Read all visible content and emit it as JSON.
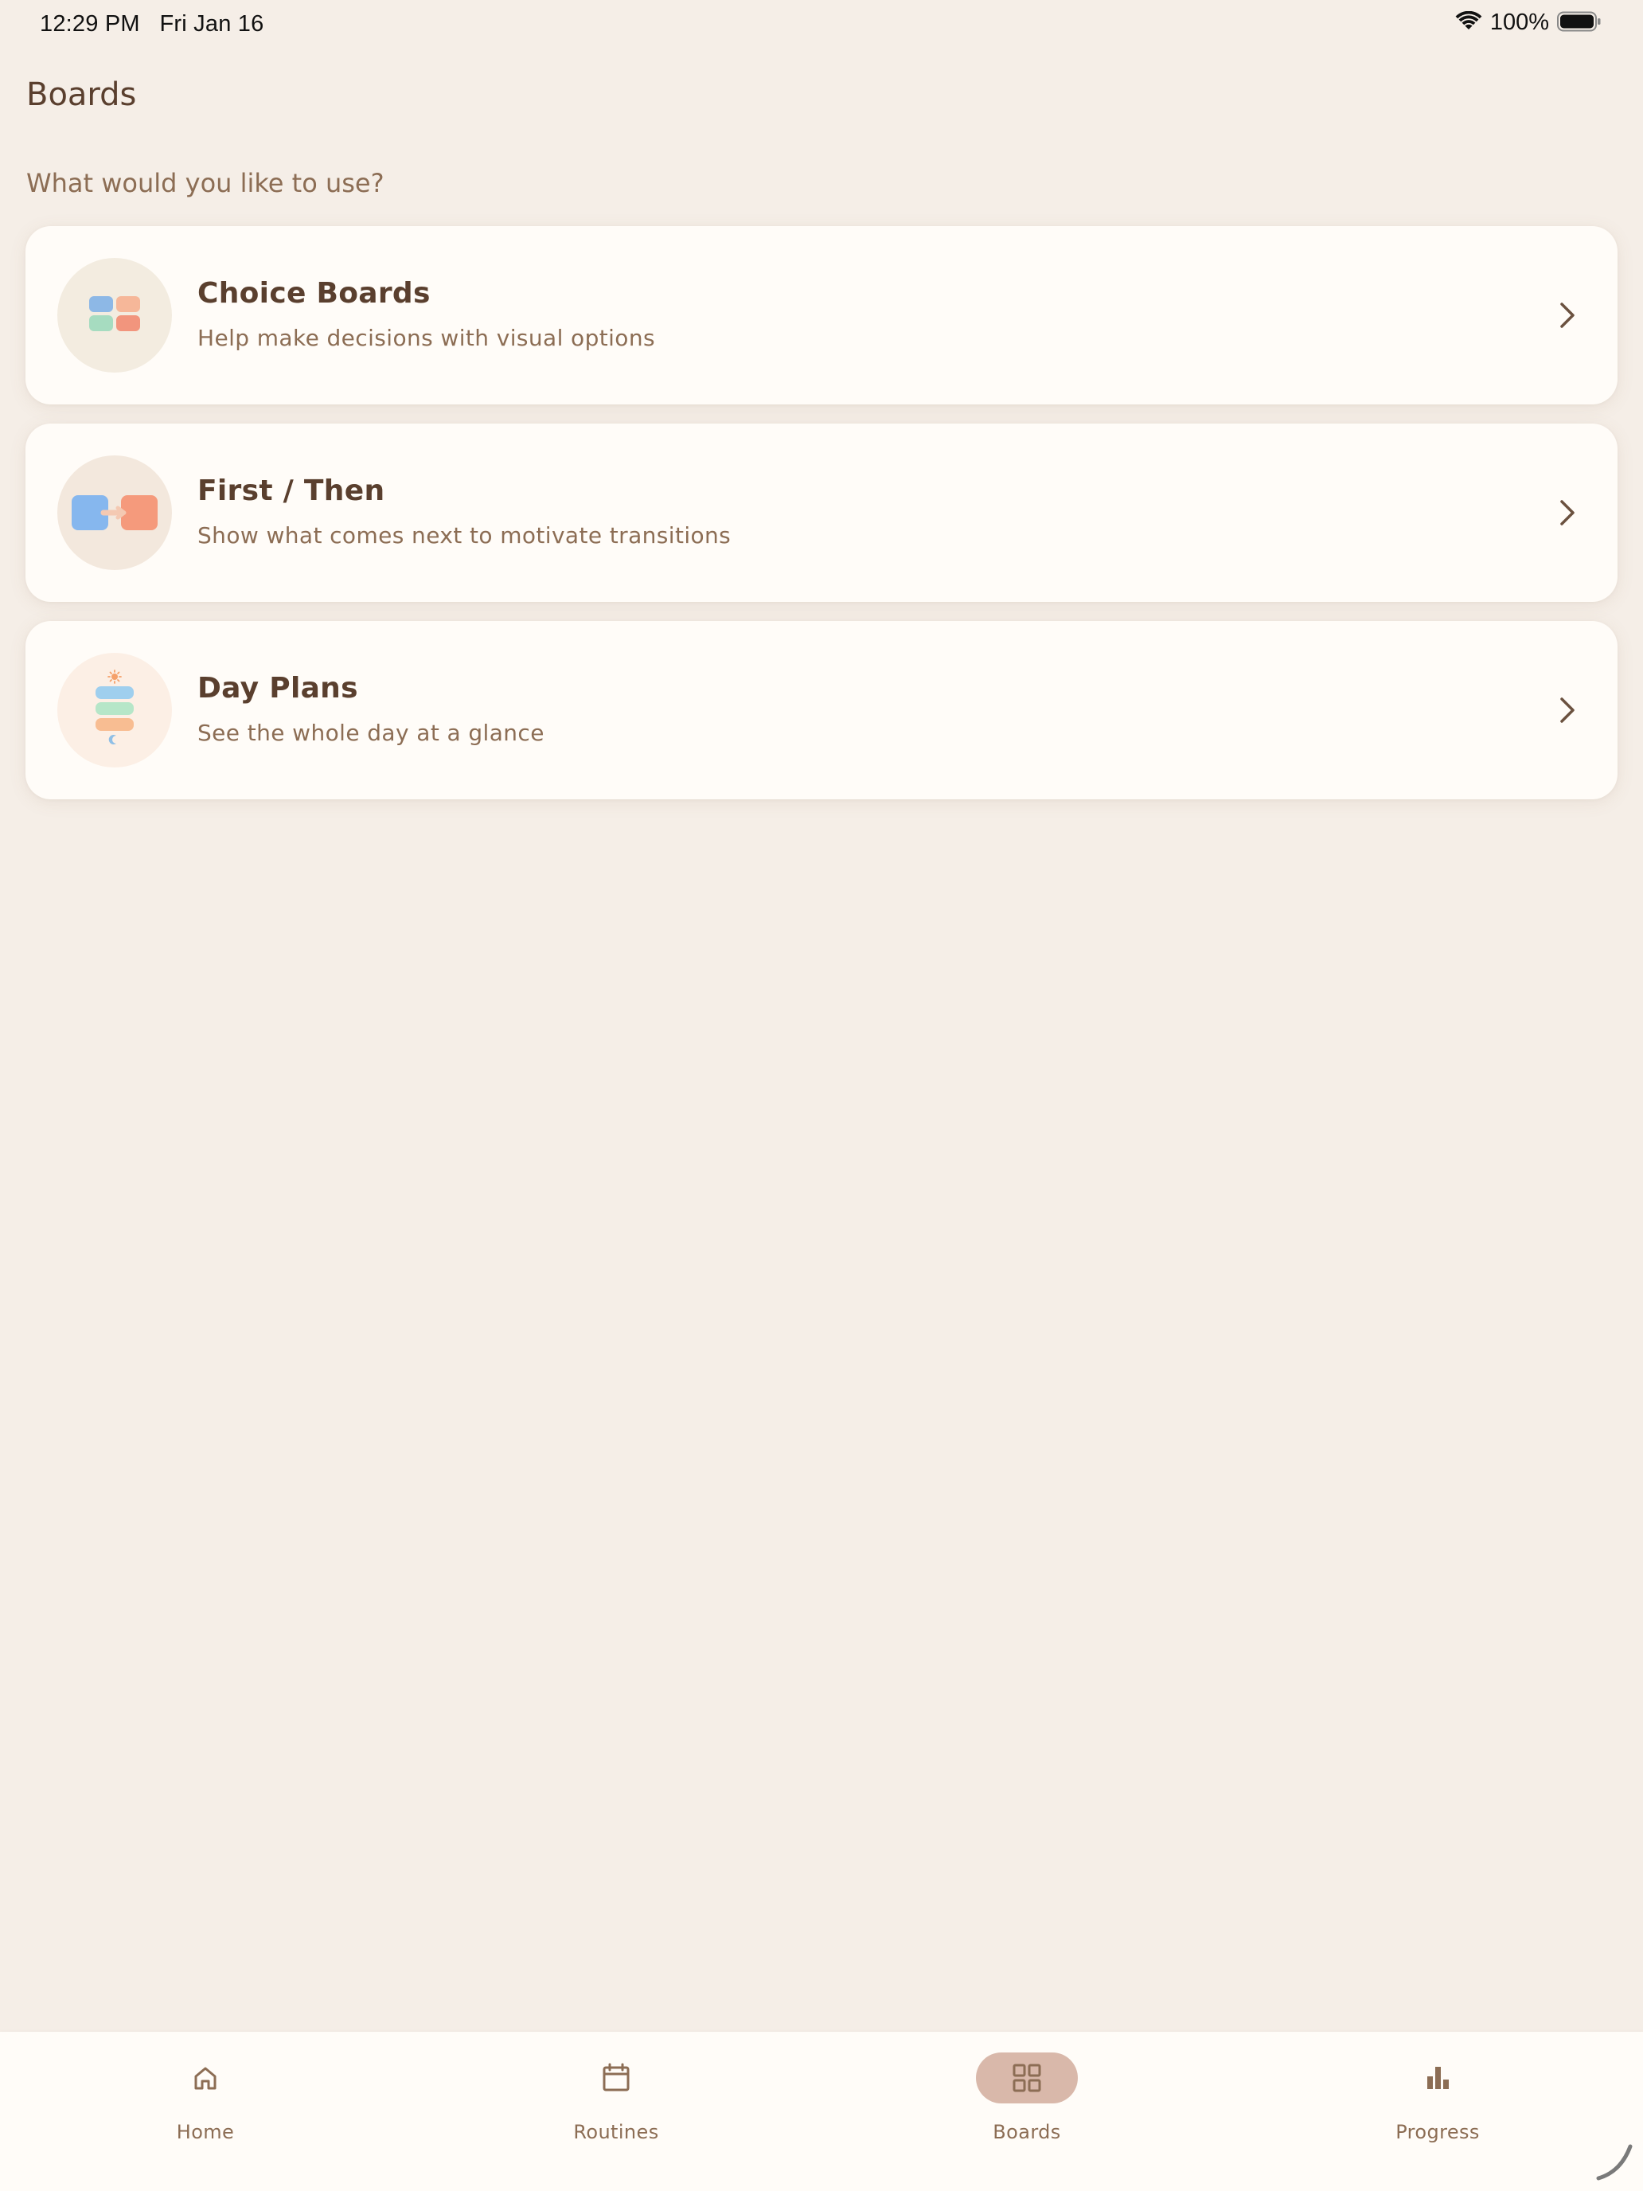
{
  "status_bar": {
    "time": "12:29 PM",
    "date": "Fri Jan 16",
    "battery": "100%",
    "wifi_icon": "wifi-icon",
    "battery_icon": "battery-icon"
  },
  "page": {
    "title": "Boards",
    "prompt": "What would you like to use?"
  },
  "cards": [
    {
      "title": "Choice Boards",
      "subtitle": "Help make decisions with visual options",
      "icon": "choice-grid-icon",
      "icon_bg": "#f3ece0"
    },
    {
      "title": "First / Then",
      "subtitle": "Show what comes next to motivate transitions",
      "icon": "first-then-icon",
      "icon_bg": "#f3e8dd"
    },
    {
      "title": "Day Plans",
      "subtitle": "See the whole day at a glance",
      "icon": "day-plan-icon",
      "icon_bg": "#fcefe5"
    }
  ],
  "tabs": [
    {
      "label": "Home",
      "icon": "home-icon",
      "active": false
    },
    {
      "label": "Routines",
      "icon": "calendar-icon",
      "active": false
    },
    {
      "label": "Boards",
      "icon": "grid-icon",
      "active": true
    },
    {
      "label": "Progress",
      "icon": "bar-chart-icon",
      "active": false
    }
  ],
  "colors": {
    "background": "#f5eee7",
    "card": "#fffcf8",
    "title_text": "#5a3f2e",
    "muted_text": "#8c6d54",
    "active_tab_pill": "#d9b8aa"
  }
}
